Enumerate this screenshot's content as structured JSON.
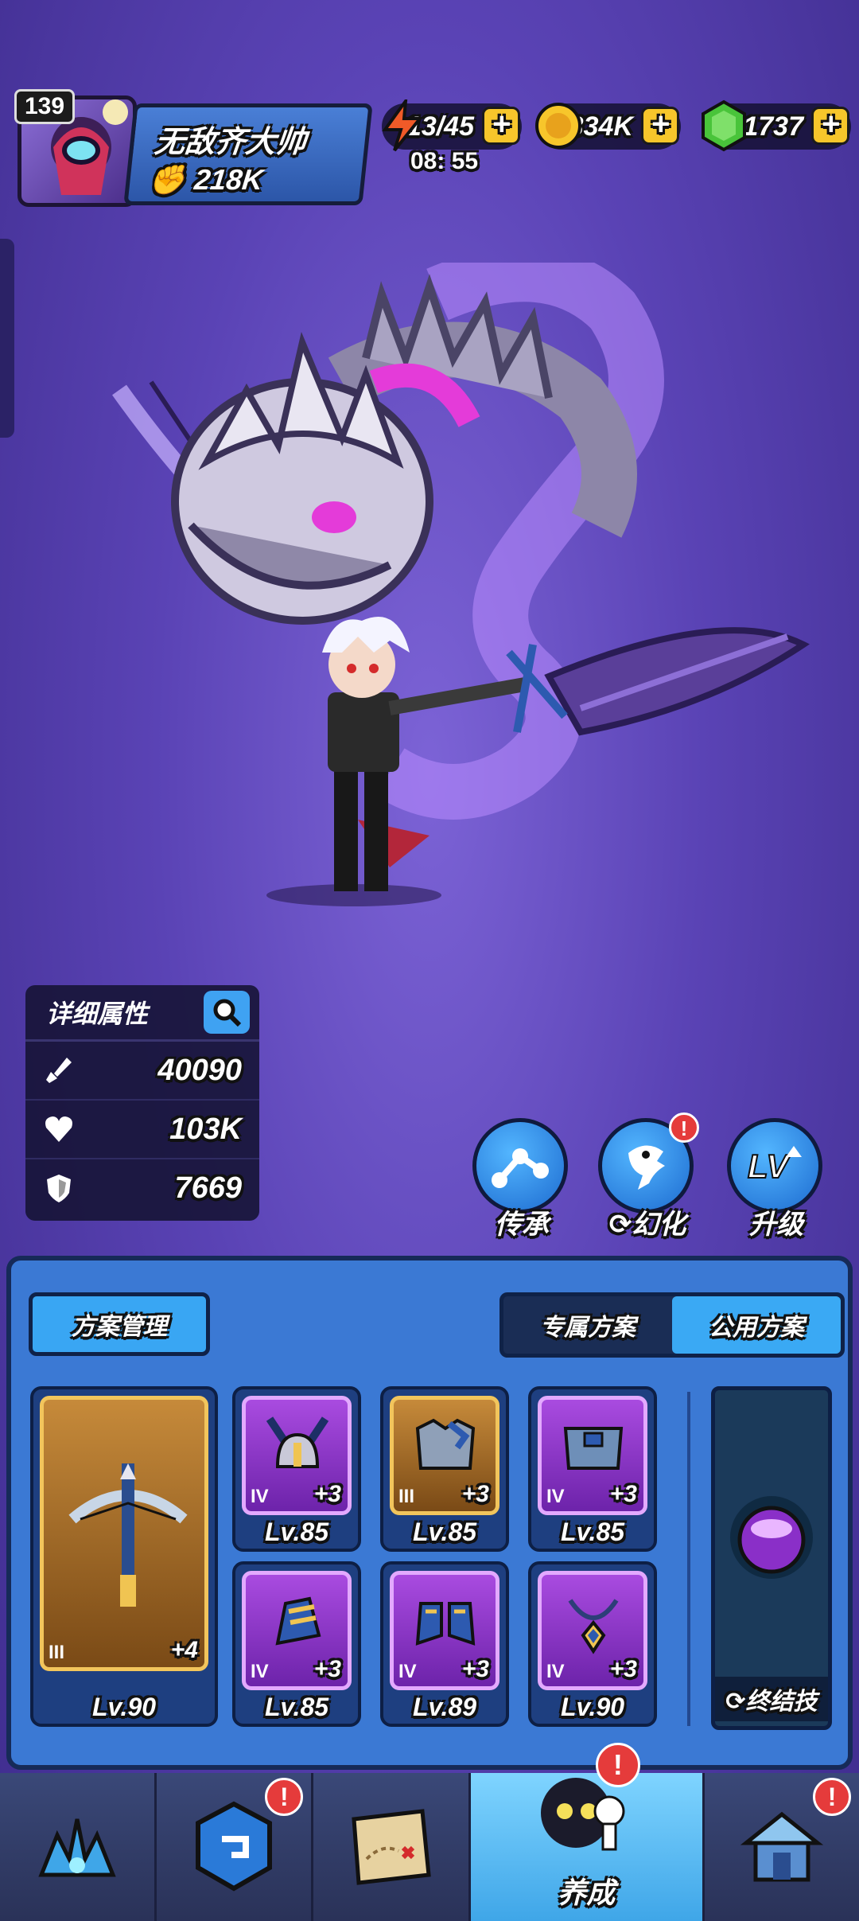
{
  "profile": {
    "level": "139",
    "name": "无敌齐大帅",
    "power": "218K"
  },
  "resources": {
    "energy": "13/45",
    "energy_timer": "08: 55",
    "gold": "1334K",
    "gems": "1737"
  },
  "stats_panel": {
    "title": "详细属性",
    "attack": "40090",
    "hp": "103K",
    "defense": "7669"
  },
  "actions": [
    {
      "label": "传承",
      "icon": "inherit-icon"
    },
    {
      "label": "幻化",
      "icon": "transform-icon",
      "badge": "!"
    },
    {
      "label": "升级",
      "icon": "level-up-icon"
    }
  ],
  "panel": {
    "plan_button": "方案管理",
    "tab_exclusive": "专属方案",
    "tab_shared": "公用方案",
    "weapon": {
      "tier": "III",
      "plus": "+4",
      "level": "Lv.90"
    },
    "gear": [
      {
        "tier": "IV",
        "plus": "+3",
        "level": "Lv.85",
        "rarity": "purple",
        "icon": "helmet-icon"
      },
      {
        "tier": "III",
        "plus": "+3",
        "level": "Lv.85",
        "rarity": "orange",
        "icon": "armor-icon"
      },
      {
        "tier": "IV",
        "plus": "+3",
        "level": "Lv.85",
        "rarity": "purple",
        "icon": "belt-icon"
      },
      {
        "tier": "IV",
        "plus": "+3",
        "level": "Lv.85",
        "rarity": "purple",
        "icon": "gauntlet-icon"
      },
      {
        "tier": "IV",
        "plus": "+3",
        "level": "Lv.89",
        "rarity": "purple",
        "icon": "boots-icon"
      },
      {
        "tier": "IV",
        "plus": "+3",
        "level": "Lv.90",
        "rarity": "purple",
        "icon": "necklace-icon"
      }
    ],
    "ultimate_label": "终结技"
  },
  "nav": {
    "active_label": "养成",
    "badge": "!"
  }
}
